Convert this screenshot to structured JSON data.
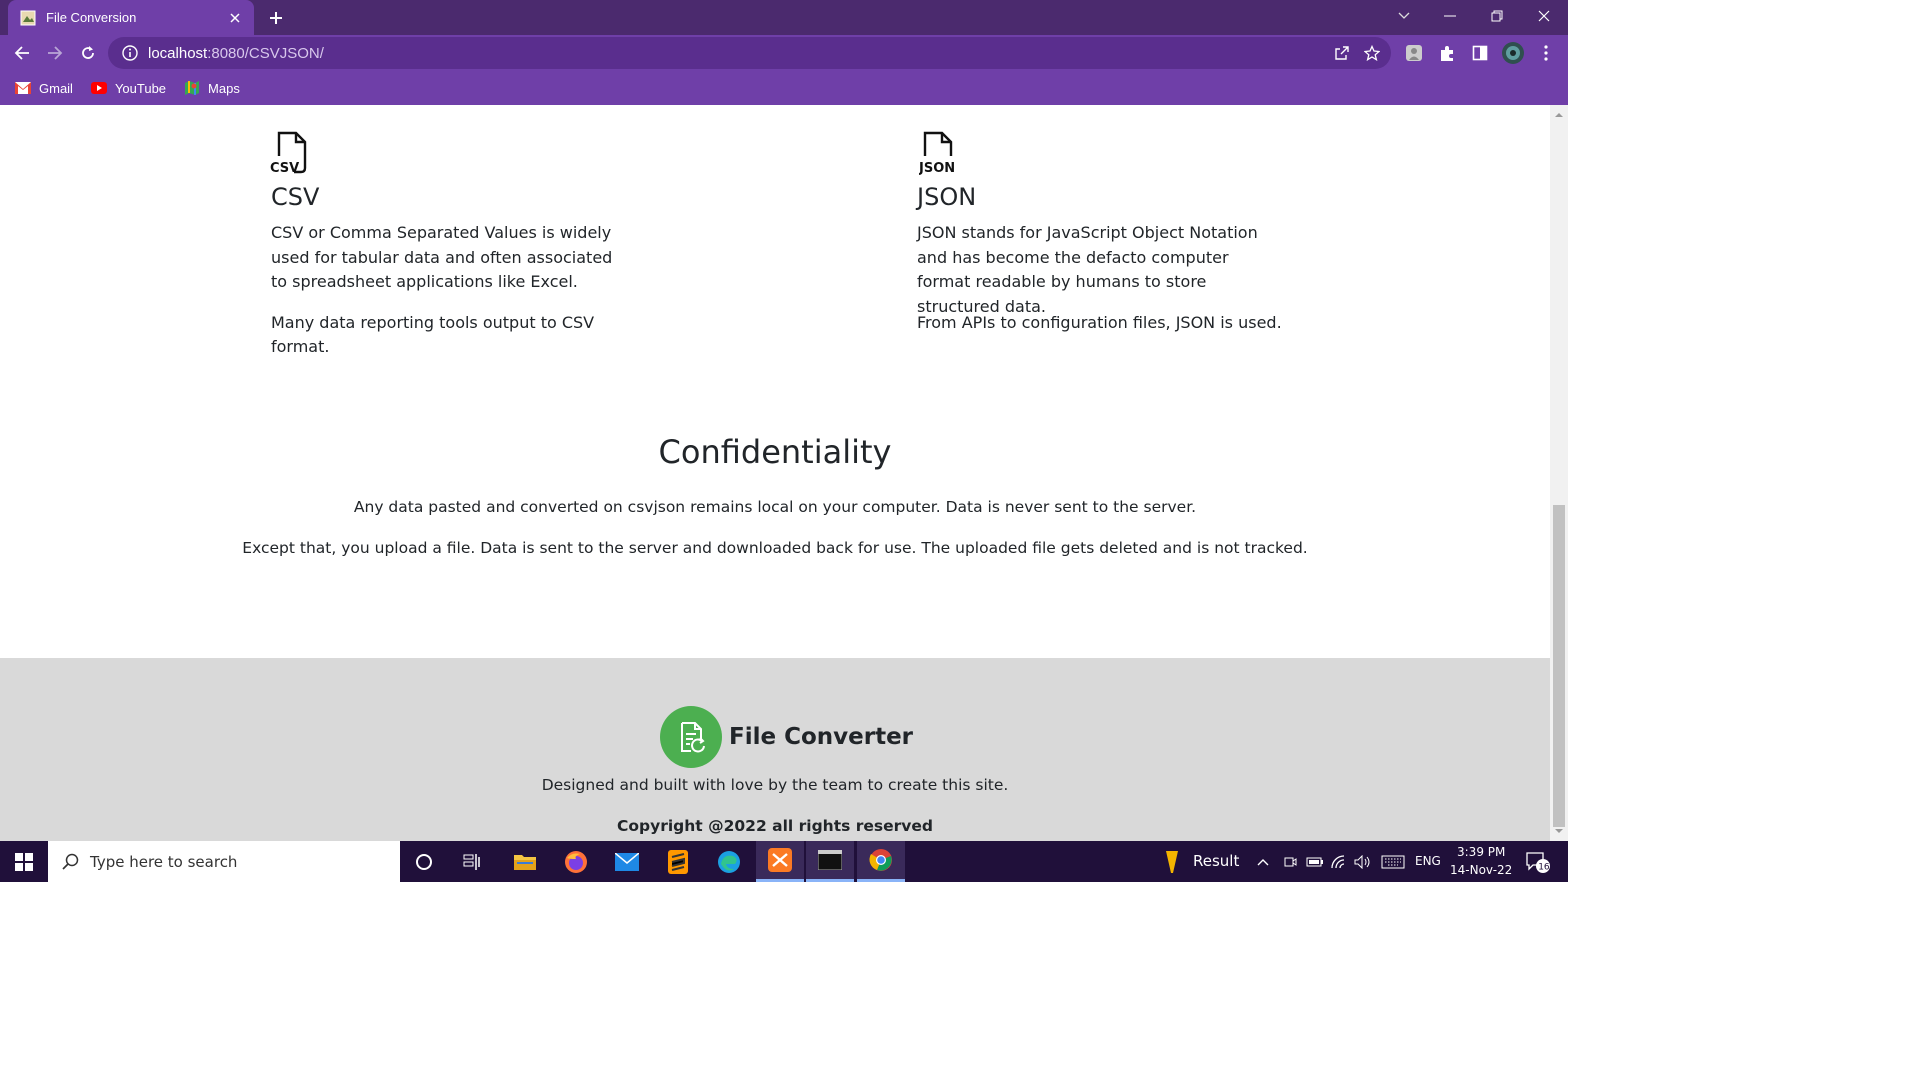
{
  "browser": {
    "tab_title": "File Conversion",
    "url_host": "localhost",
    "url_rest": ":8080/CSVJSON/",
    "bookmarks": [
      {
        "label": "Gmail",
        "icon": "gmail-icon"
      },
      {
        "label": "YouTube",
        "icon": "youtube-icon"
      },
      {
        "label": "Maps",
        "icon": "maps-icon"
      }
    ],
    "theme_color": "#6f3fa8"
  },
  "formats": {
    "csv": {
      "icon_label": "CSV",
      "title": "CSV",
      "desc": "CSV or Comma Separated Values is widely used for tabular data and often associated to spreadsheet applications like Excel.",
      "note": "Many data reporting tools output to CSV format."
    },
    "json": {
      "icon_label": "JSON",
      "title": "JSON",
      "desc": "JSON stands for JavaScript Object Notation and has become the defacto computer format readable by humans to store structured data.",
      "note": "From APIs to configuration files, JSON is used."
    }
  },
  "confidentiality": {
    "title": "Confidentiality",
    "p1": "Any data pasted and converted on csvjson remains local on your computer. Data is never sent to the server.",
    "p2": "Except that, you upload a file. Data is sent to the server and downloaded back for use. The uploaded file gets deleted and is not tracked."
  },
  "footer": {
    "brand": "File Converter",
    "tagline": "Designed and built with love by the team to create this site.",
    "copyright": "Copyright @2022 all rights reserved",
    "logo_color": "#4caf50"
  },
  "taskbar": {
    "search_placeholder": "Type here to search",
    "result_label": "Result",
    "lang": "ENG",
    "time": "3:39 PM",
    "date": "14-Nov-22",
    "notification_count": "16"
  }
}
